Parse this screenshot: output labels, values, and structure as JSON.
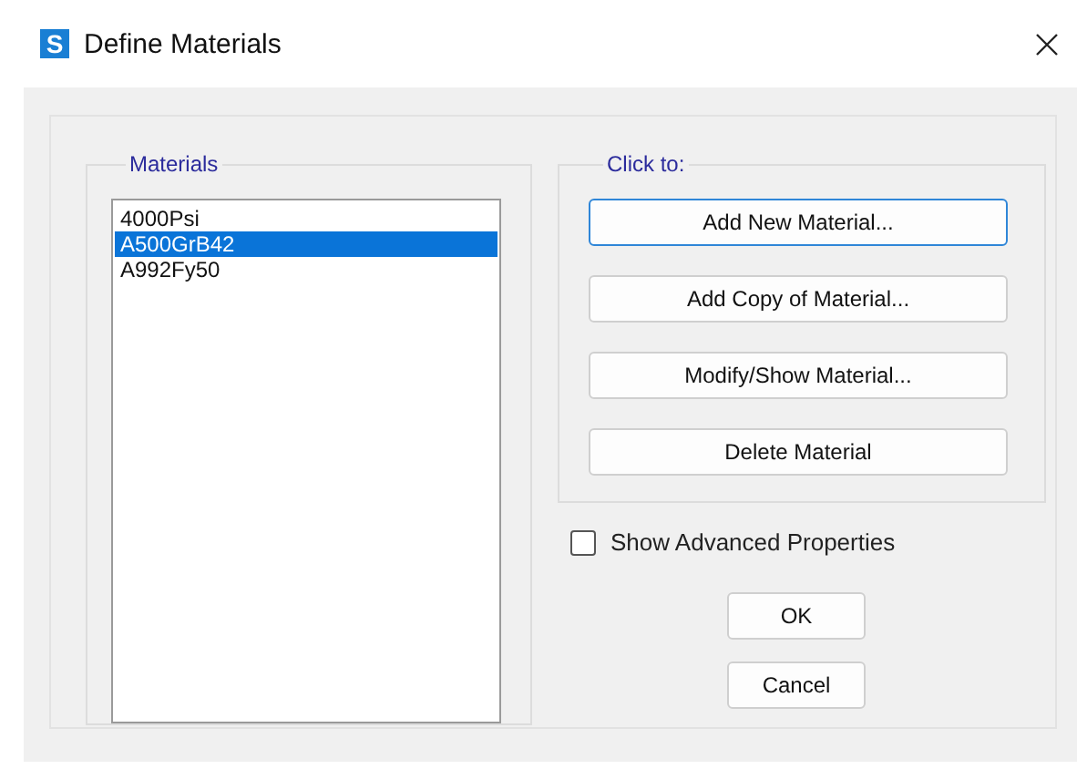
{
  "window": {
    "app_letter": "S",
    "title": "Define Materials"
  },
  "materials": {
    "label": "Materials",
    "items": [
      {
        "name": "4000Psi",
        "selected": false
      },
      {
        "name": "A500GrB42",
        "selected": true
      },
      {
        "name": "A992Fy50",
        "selected": false
      }
    ]
  },
  "click_to": {
    "label": "Click to:",
    "buttons": [
      {
        "label": "Add New Material...",
        "focused": true
      },
      {
        "label": "Add Copy of Material...",
        "focused": false
      },
      {
        "label": "Modify/Show Material...",
        "focused": false
      },
      {
        "label": "Delete Material",
        "focused": false
      }
    ]
  },
  "show_advanced": {
    "label": "Show Advanced Properties",
    "checked": false
  },
  "buttons": [
    "OK",
    "Cancel"
  ]
}
